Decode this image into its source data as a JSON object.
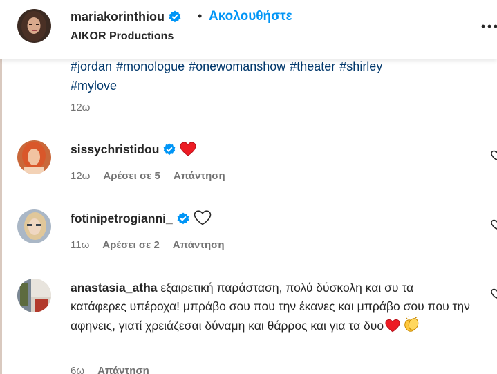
{
  "header": {
    "username": "mariakorinthiou",
    "dot": "•",
    "follow_label": "Ακολουθήστε",
    "subtitle": "AIKOR Productions"
  },
  "caption": {
    "hashtags": [
      "#jordan",
      "#monologue",
      "#onewomanshow",
      "#theater",
      "#shirley",
      "#mylove"
    ],
    "time": "12ω"
  },
  "comments": [
    {
      "username": "sissychristidou",
      "text": "",
      "verified": true,
      "emoji": "red-heart-icon",
      "time": "12ω",
      "likes": "Αρέσει σε 5",
      "reply": "Απάντηση"
    },
    {
      "username": "fotinipetrogianni_",
      "text": "",
      "verified": true,
      "emoji": "white-heart-icon",
      "time": "11ω",
      "likes": "Αρέσει σε 2",
      "reply": "Απάντηση"
    },
    {
      "username": "anastasia_atha",
      "text": "εξαιρετική παράσταση, πολύ δύσκολη και συ τα κατάφερες υπέροχα! μπράβο σου που την έκανες και μπράβο σου που την αφηνεις, γιατί χρειάζεσαι δύναμη και θάρρος και για τα δυο",
      "verified": false,
      "emoji": "red-heart-and-clapping-hands-icons",
      "time": "6ω",
      "likes": "",
      "reply": "Απάντηση"
    }
  ],
  "colors": {
    "link_blue": "#00376b",
    "follow_blue": "#0095f6",
    "verified_blue": "#0095f6",
    "secondary_text": "#737373",
    "heart_red": "#ed1c24"
  }
}
